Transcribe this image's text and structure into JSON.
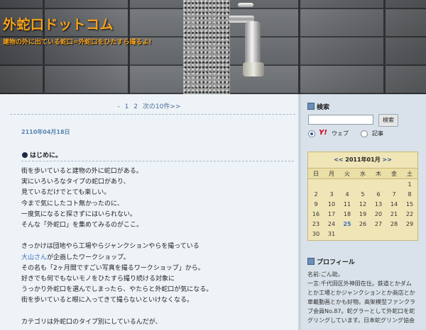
{
  "header": {
    "site_title": "外蛇口ドットコム",
    "site_description": "建物の外に出ている蛇口=外蛇口をひたすら撮るよ!"
  },
  "pager": {
    "dash": "-",
    "pages": [
      "1",
      "2"
    ],
    "next_label": "次の10件>>"
  },
  "post": {
    "date": "2110年04月18日",
    "title": "はじめに。",
    "lines": [
      "街を歩いていると建物の外に蛇口がある。",
      "実にいろいろなタイプの蛇口があり、",
      "見ているだけでとても楽しい。",
      "今まで気にしたコト無かったのに、",
      "一度気になると探さずにはいられない。",
      "そんな「外蛇口」を集めてみるのがここ。",
      "",
      "きっかけは団地やら工場やらジャンクションやらを撮っている",
      "",
      "その名も「2ヶ月間ですごい写真を撮るワークショップ」から。",
      "好きでも何でもないモノをひたすら撮り続ける対象に",
      "うっかり外蛇口を選んでしまったら、やたらと外蛇口が気になる。",
      "街を歩いていると眼に入ってきて撮らないといけなくなる。",
      "",
      "カテゴリは外蛇口のタイプ別にしているんだが、"
    ],
    "link_line": {
      "link_text": "大山さん",
      "rest": "が企画したワークショップ。"
    }
  },
  "sidebar": {
    "search": {
      "heading": "検索",
      "button_label": "検索",
      "input_value": "",
      "option_web_logo": "Y!",
      "option_web_label": "ウェブ",
      "option_entries_label": "記事",
      "selected": "web"
    },
    "calendar": {
      "prev": "<<",
      "next": ">>",
      "month_label": "2011年01月",
      "weekdays": [
        "日",
        "月",
        "火",
        "水",
        "木",
        "金",
        "土"
      ],
      "weeks": [
        [
          "",
          "",
          "",
          "",
          "",
          "",
          "1"
        ],
        [
          "2",
          "3",
          "4",
          "5",
          "6",
          "7",
          "8"
        ],
        [
          "9",
          "10",
          "11",
          "12",
          "13",
          "14",
          "15"
        ],
        [
          "16",
          "17",
          "18",
          "19",
          "20",
          "21",
          "22"
        ],
        [
          "23",
          "24",
          "25",
          "26",
          "27",
          "28",
          "29"
        ],
        [
          "30",
          "31",
          "",
          "",
          "",
          "",
          ""
        ]
      ],
      "highlight": "25"
    },
    "profile": {
      "heading": "プロフィール",
      "lines": [
        "名前:ごん助。",
        "一言:千代田区外神田在住。鉄道とかダム",
        "とか工場とかジャンクションとか商店とか",
        "車載動画とかも好物。高架模型ファンクラ",
        "ブ会員No.87。蛇グラーとして外蛇口を蛇",
        "グリングしています。日本蛇グリング協会"
      ]
    }
  },
  "colors": {
    "title_orange": "#f7a21b",
    "link_blue": "#3a6ec0",
    "calendar_bg": "#efe5b7"
  }
}
